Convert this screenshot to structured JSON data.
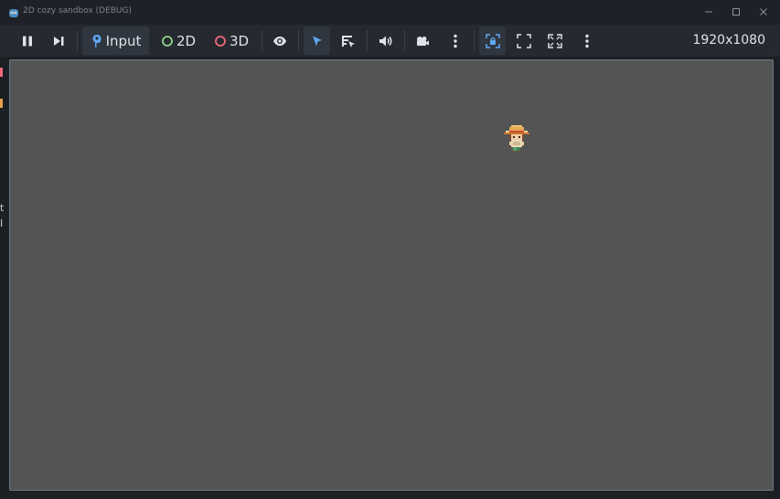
{
  "window": {
    "title": "2D cozy sandbox (DEBUG)",
    "controls": [
      "minimize",
      "maximize",
      "close"
    ]
  },
  "toolbar": {
    "input_label": "Input",
    "2d_label": "2D",
    "3d_label": "3D",
    "resolution": "1920x1080",
    "buttons": [
      "pause-icon",
      "step-icon",
      "input-icon",
      "2d-icon",
      "3d-icon",
      "eye-icon",
      "select-arrow-icon",
      "list-select-icon",
      "speaker-icon",
      "camera-icon",
      "more-vertical-icon",
      "lock-camera-icon",
      "fit-icon",
      "fullscreen-icon",
      "more-vertical-icon"
    ],
    "colors": {
      "accent_blue": "#5fa6f0",
      "2d_green": "#8ed488",
      "3d_red": "#f06a7a"
    }
  },
  "game": {
    "background": "#545454",
    "sprite": "character-with-straw-hat"
  },
  "left_strip": {
    "marks": [
      "t",
      "I"
    ]
  }
}
